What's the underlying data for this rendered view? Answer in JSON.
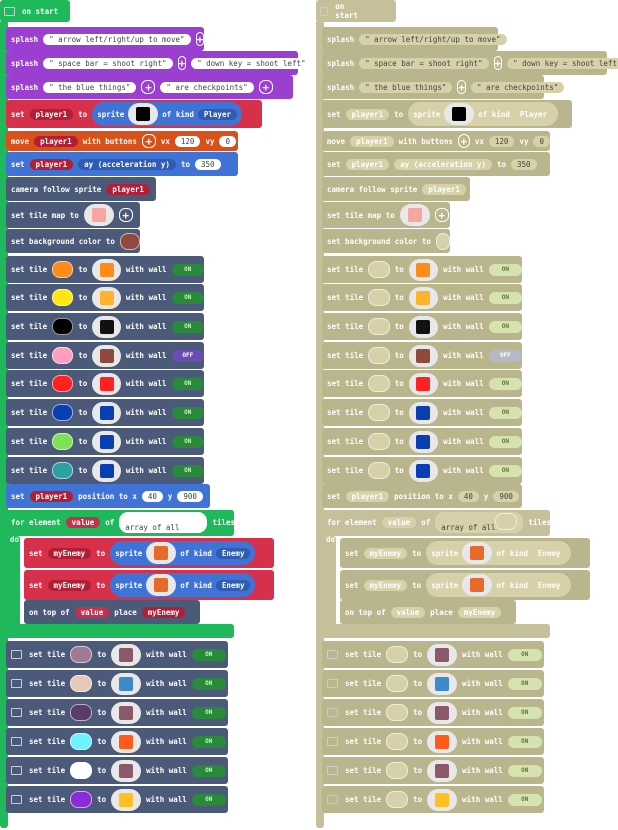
{
  "left": {
    "hat": "on start",
    "splash": [
      {
        "kw": "splash",
        "args": [
          "\" arrow left/right/up to move\""
        ]
      },
      {
        "kw": "splash",
        "args": [
          "\" space bar = shoot right\"",
          "\" down key = shoot left\""
        ]
      },
      {
        "kw": "splash",
        "args": [
          "\" the blue things\"",
          "\" are checkpoints\""
        ]
      }
    ],
    "set_player": {
      "kw": "set",
      "var": "player1",
      "to": "to",
      "sprite": "sprite",
      "of_kind": "of kind",
      "kind": "Player"
    },
    "move": {
      "kw": "move",
      "var": "player1",
      "with": "with buttons",
      "vx_label": "vx",
      "vx": "120",
      "vy_label": "vy",
      "vy": "0"
    },
    "accel": {
      "kw": "set",
      "var": "player1",
      "prop": "ay (acceleration y)",
      "to": "to",
      "val": "350"
    },
    "camera": {
      "text": "camera follow sprite",
      "var": "player1"
    },
    "tilemap": {
      "text": "set tile map to"
    },
    "bg": {
      "text": "set background color to",
      "color": "#8e4a3c"
    },
    "tiles": [
      {
        "c": "#ff8c1a",
        "t": "#ff8c1a",
        "w": "ON"
      },
      {
        "c": "#ffe70f",
        "t": "#ffb32a",
        "w": "ON"
      },
      {
        "c": "#000000",
        "t": "#111111",
        "w": "ON"
      },
      {
        "c": "#ff9ebf",
        "t": "#8e4a3c",
        "w": "OFF"
      },
      {
        "c": "#ff2121",
        "t": "#ff2121",
        "w": "ON"
      },
      {
        "c": "#0a3fb3",
        "t": "#0a3fb3",
        "w": "ON"
      },
      {
        "c": "#7ee055",
        "t": "#0a3fb3",
        "w": "ON"
      },
      {
        "c": "#2aa1a0",
        "t": "#0a3fb3",
        "w": "ON"
      }
    ],
    "tile_labels": {
      "set_tile": "set tile",
      "to": "to",
      "with_wall": "with wall"
    },
    "position": {
      "kw": "set",
      "var": "player1",
      "text": "position to x",
      "x": "40",
      "y_label": "y",
      "y": "900"
    },
    "for": {
      "kw": "for element",
      "var": "value",
      "of": "of",
      "arr": "array of all",
      "tiles": "tiles",
      "do": "do"
    },
    "enemy": [
      {
        "kw": "set",
        "var": "myEnemy",
        "to": "to",
        "sprite": "sprite",
        "of_kind": "of kind",
        "kind": "Enemy"
      },
      {
        "kw": "set",
        "var": "myEnemy",
        "to": "to",
        "sprite": "sprite",
        "of_kind": "of kind",
        "kind": "Enemy"
      }
    ],
    "ontop": {
      "kw": "on top of",
      "var": "value",
      "place": "place",
      "what": "myEnemy"
    },
    "bottom_tiles": [
      {
        "c": "#a07a94",
        "t": "#8a5a6a",
        "w": "ON"
      },
      {
        "c": "#e6c9bb",
        "t": "#3a8acc",
        "w": "ON"
      },
      {
        "c": "#5a3b6b",
        "t": "#8a5a6a",
        "w": "ON"
      },
      {
        "c": "#6ef2ff",
        "t": "#ff5a1a",
        "w": "ON"
      },
      {
        "c": "#ffffff",
        "t": "#8a5a6a",
        "w": "ON"
      },
      {
        "c": "#8b2cd6",
        "t": "#ffc020",
        "w": "ON"
      }
    ]
  },
  "right": {
    "hat": "on start",
    "splash": [
      {
        "kw": "splash",
        "args": [
          "\" arrow left/right/up to move\""
        ]
      },
      {
        "kw": "splash",
        "args": [
          "\" space bar = shoot right\"",
          "\" down key = shoot left\""
        ]
      },
      {
        "kw": "splash",
        "args": [
          "\" the blue things\"",
          "\" are checkpoints\""
        ]
      }
    ],
    "set_player": {
      "kw": "set",
      "var": "player1",
      "to": "to",
      "sprite": "sprite",
      "of_kind": "of kind",
      "kind": "Player"
    },
    "move": {
      "kw": "move",
      "var": "player1",
      "with": "with buttons",
      "vx_label": "vx",
      "vx": "120",
      "vy_label": "vy",
      "vy": "0"
    },
    "accel": {
      "kw": "set",
      "var": "player1",
      "prop": "ay (acceleration y)",
      "to": "to",
      "val": "350"
    },
    "camera": {
      "text": "camera follow sprite",
      "var": "player1"
    },
    "tilemap": {
      "text": "set tile map to"
    },
    "bg": {
      "text": "set background color to"
    },
    "tiles": [
      {
        "t": "#ff8c1a",
        "w": "ON"
      },
      {
        "t": "#ffb32a",
        "w": "ON"
      },
      {
        "t": "#111111",
        "w": "ON"
      },
      {
        "t": "#8e4a3c",
        "w": "OFF"
      },
      {
        "t": "#ff2121",
        "w": "ON"
      },
      {
        "t": "#0a3fb3",
        "w": "ON"
      },
      {
        "t": "#0a3fb3",
        "w": "ON"
      },
      {
        "t": "#0a3fb3",
        "w": "ON"
      }
    ],
    "tile_labels": {
      "set_tile": "set tile",
      "to": "to",
      "with_wall": "with wall"
    },
    "position": {
      "kw": "set",
      "var": "player1",
      "text": "position to x",
      "x": "40",
      "y_label": "y",
      "y": "900"
    },
    "for": {
      "kw": "for element",
      "var": "value",
      "of": "of",
      "arr": "array of all",
      "tiles": "tiles",
      "do": "do"
    },
    "enemy": [
      {
        "kw": "set",
        "var": "myEnemy",
        "to": "to",
        "sprite": "sprite",
        "of_kind": "of kind",
        "kind": "Enemy"
      },
      {
        "kw": "set",
        "var": "myEnemy",
        "to": "to",
        "sprite": "sprite",
        "of_kind": "of kind",
        "kind": "Enemy"
      }
    ],
    "ontop": {
      "kw": "on top of",
      "var": "value",
      "place": "place",
      "what": "myEnemy"
    },
    "bottom_tiles": [
      {
        "t": "#8a5a6a",
        "w": "ON"
      },
      {
        "t": "#3a8acc",
        "w": "ON"
      },
      {
        "t": "#8a5a6a",
        "w": "ON"
      },
      {
        "t": "#ff5a1a",
        "w": "ON"
      },
      {
        "t": "#8a5a6a",
        "w": "ON"
      },
      {
        "t": "#ffc020",
        "w": "ON"
      }
    ]
  },
  "colors": {
    "green": "#1fb85a",
    "purple": "#9b3fd1",
    "red": "#d6304a",
    "orange": "#d9511a",
    "blue": "#3f74d6",
    "slate": "#4b5a78",
    "gray_panel": "#c6c09a",
    "gray_block": "#b9b58d",
    "gray_field": "#d6d1a9"
  }
}
